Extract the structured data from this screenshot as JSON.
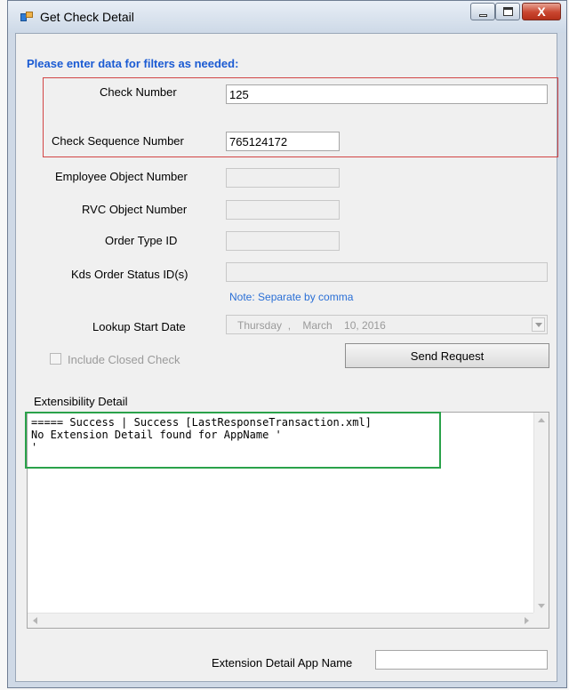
{
  "window": {
    "title": "Get Check Detail",
    "close_glyph": "X",
    "icon": "app-form-icon"
  },
  "form": {
    "heading": "Please enter data for filters as needed:",
    "check_number_label": "Check Number",
    "check_number_value": "125",
    "check_sequence_label": "Check Sequence Number",
    "check_sequence_value": "765124172",
    "employee_object_label": "Employee Object Number",
    "employee_object_value": "",
    "rvc_object_label": "RVC Object Number",
    "rvc_object_value": "",
    "order_type_label": "Order Type ID",
    "order_type_value": "",
    "kds_status_label": "Kds Order Status ID(s)",
    "kds_status_value": "",
    "kds_note": "Note: Separate by comma",
    "lookup_start_label": "Lookup Start Date",
    "lookup_start_value": "Thursday  ,    March    10, 2016",
    "include_closed_label": "Include Closed Check",
    "send_request_label": "Send Request"
  },
  "detail": {
    "label": "Extensibility Detail",
    "text": "===== Success | Success [LastResponseTransaction.xml]\nNo Extension Detail found for AppName '\n'",
    "app_name_label": "Extension Detail App Name",
    "app_name_value": ""
  },
  "colors": {
    "heading": "#1b5bd3",
    "note": "#2a6fd6",
    "highlight_red": "#d24545",
    "highlight_green": "#2aa24a"
  }
}
